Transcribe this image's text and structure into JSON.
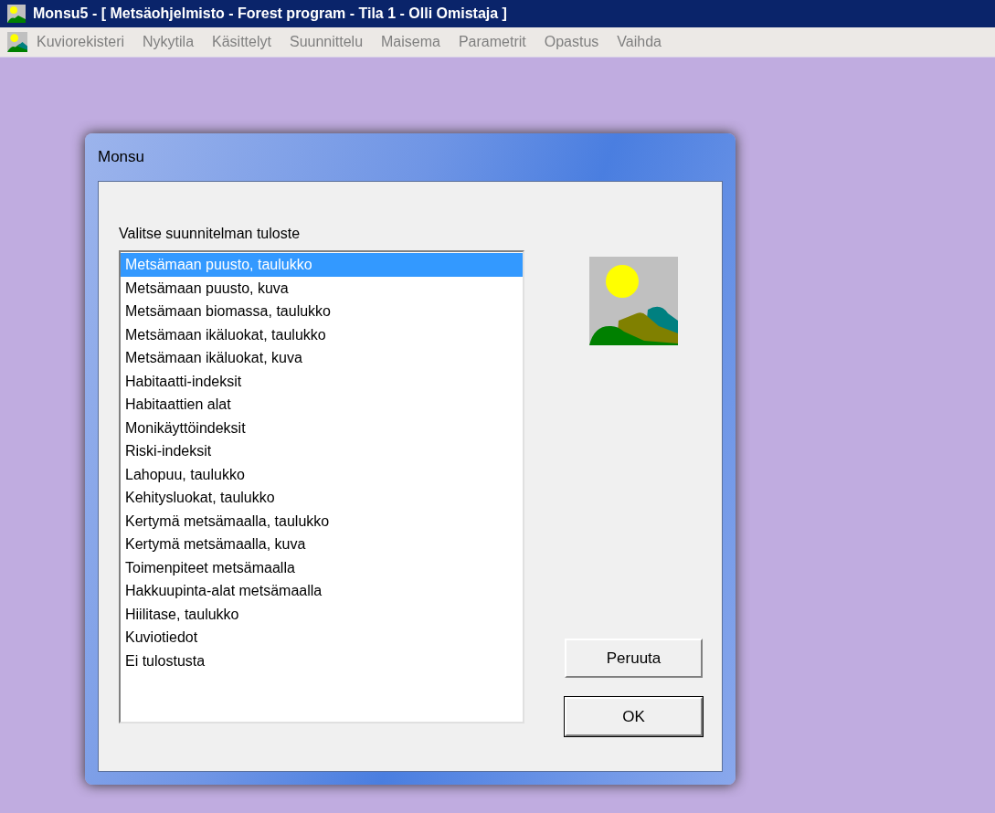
{
  "window": {
    "title": "Monsu5 - [ Metsäohjelmisto - Forest program - Tila   1 - Olli Omistaja ]"
  },
  "menu": [
    {
      "label": "Kuviorekisteri",
      "disabled": true
    },
    {
      "label": "Nykytila",
      "disabled": true
    },
    {
      "label": "Käsittelyt",
      "disabled": true
    },
    {
      "label": "Suunnittelu",
      "disabled": true
    },
    {
      "label": "Maisema",
      "disabled": true
    },
    {
      "label": "Parametrit",
      "disabled": true
    },
    {
      "label": "Opastus",
      "disabled": true
    },
    {
      "label": "Vaihda",
      "disabled": true
    }
  ],
  "dialog": {
    "title": "Monsu",
    "prompt": "Valitse suunnitelman tuloste",
    "items": [
      {
        "label": "Metsämaan puusto, taulukko",
        "selected": true
      },
      {
        "label": "Metsämaan puusto, kuva",
        "selected": false
      },
      {
        "label": "Metsämaan biomassa, taulukko",
        "selected": false
      },
      {
        "label": "Metsämaan ikäluokat, taulukko",
        "selected": false
      },
      {
        "label": "Metsämaan ikäluokat, kuva",
        "selected": false
      },
      {
        "label": "Habitaatti-indeksit",
        "selected": false
      },
      {
        "label": "Habitaattien alat",
        "selected": false
      },
      {
        "label": "Monikäyttöindeksit",
        "selected": false
      },
      {
        "label": "Riski-indeksit",
        "selected": false
      },
      {
        "label": "Lahopuu, taulukko",
        "selected": false
      },
      {
        "label": "Kehitysluokat, taulukko",
        "selected": false
      },
      {
        "label": "Kertymä metsämaalla, taulukko",
        "selected": false
      },
      {
        "label": "Kertymä metsämaalla, kuva",
        "selected": false
      },
      {
        "label": "Toimenpiteet metsämaalla",
        "selected": false
      },
      {
        "label": "Hakkuupinta-alat metsämaalla",
        "selected": false
      },
      {
        "label": "Hiilitase, taulukko",
        "selected": false
      },
      {
        "label": "Kuviotiedot",
        "selected": false
      },
      {
        "label": "Ei tulostusta",
        "selected": false
      }
    ],
    "buttons": [
      "Peruuta",
      "OK"
    ]
  }
}
